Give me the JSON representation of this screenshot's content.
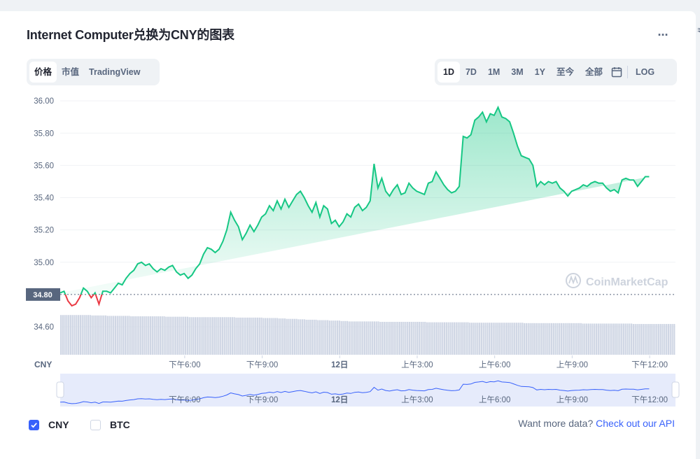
{
  "page": {
    "title": "Internet Computer兑换为CNY的图表",
    "edge_glyph": "₹",
    "more_label": "..."
  },
  "left_tabs": [
    {
      "label": "价格",
      "active": true
    },
    {
      "label": "市值",
      "active": false
    },
    {
      "label": "TradingView",
      "active": false
    }
  ],
  "range_tabs": [
    {
      "label": "1D",
      "active": true
    },
    {
      "label": "7D",
      "active": false
    },
    {
      "label": "1M",
      "active": false
    },
    {
      "label": "3M",
      "active": false
    },
    {
      "label": "1Y",
      "active": false
    },
    {
      "label": "至今",
      "active": false
    },
    {
      "label": "全部",
      "active": false
    }
  ],
  "icons": {
    "calendar": "calendar-icon",
    "check": "check-icon",
    "more": "more-horizontal-icon",
    "watermark": "coinmarketcap-logo-icon"
  },
  "log_label": "LOG",
  "watermark": "CoinMarketCap",
  "legend": {
    "cny": {
      "label": "CNY",
      "checked": true
    },
    "btc": {
      "label": "BTC",
      "checked": false
    }
  },
  "footer": {
    "prompt": "Want more data?",
    "link": "Check out our API"
  },
  "colors": {
    "up": "#16c784",
    "down": "#ea3943",
    "accent": "#3861fb",
    "volume": "#cfd6e4"
  },
  "chart_data": {
    "type": "line",
    "yticks": [
      "36.00",
      "35.80",
      "35.60",
      "35.40",
      "35.20",
      "35.00",
      "34.60"
    ],
    "ylim": [
      34.47,
      36.07
    ],
    "reference_value": 34.8,
    "reference_label": "34.80",
    "currency_label": "CNY",
    "x_tick_labels": [
      {
        "label": "下午6:00",
        "t": 4.82
      },
      {
        "label": "下午9:00",
        "t": 7.82
      },
      {
        "label": "12日",
        "t": 10.82
      },
      {
        "label": "上午3:00",
        "t": 13.82
      },
      {
        "label": "上午6:00",
        "t": 16.82
      },
      {
        "label": "上午9:00",
        "t": 19.82
      },
      {
        "label": "下午12:00",
        "t": 22.82
      }
    ],
    "x_range": [
      0,
      23.82
    ],
    "series": [
      {
        "t": [
          0,
          0.15,
          0.3,
          0.45,
          0.6,
          0.75,
          0.9,
          1.05,
          1.2,
          1.35,
          1.5,
          1.65,
          1.8,
          1.95,
          2.1,
          2.25,
          2.4,
          2.55,
          2.7,
          2.85,
          3.0,
          3.15,
          3.3,
          3.45,
          3.6,
          3.75,
          3.9,
          4.05,
          4.2,
          4.35,
          4.5,
          4.65,
          4.8,
          4.95,
          5.1,
          5.25,
          5.4,
          5.55,
          5.7,
          5.85,
          6.0,
          6.15,
          6.3,
          6.45,
          6.6,
          6.75,
          6.9,
          7.05,
          7.2,
          7.35,
          7.5,
          7.65,
          7.8,
          7.95,
          8.1,
          8.25,
          8.4,
          8.55,
          8.7,
          8.85,
          9.0,
          9.15,
          9.3,
          9.45,
          9.6,
          9.75,
          9.9,
          10.05,
          10.2,
          10.35,
          10.5,
          10.65,
          10.8,
          10.95,
          11.1,
          11.25,
          11.4,
          11.55,
          11.7,
          11.85,
          12.0,
          12.15,
          12.3,
          12.45,
          12.6,
          12.75,
          12.9,
          13.05,
          13.2,
          13.35,
          13.5,
          13.65,
          13.8,
          13.95,
          14.1,
          14.25,
          14.4,
          14.55,
          14.7,
          14.85,
          15.0,
          15.15,
          15.3,
          15.45,
          15.6,
          15.75,
          15.9,
          16.05,
          16.2,
          16.35,
          16.5,
          16.65,
          16.8,
          16.95,
          17.1,
          17.25,
          17.4,
          17.55,
          17.7,
          17.85,
          18.0,
          18.15,
          18.3,
          18.45,
          18.6,
          18.75,
          18.9,
          19.05,
          19.2,
          19.35,
          19.5,
          19.65,
          19.8,
          19.95,
          20.1,
          20.25,
          20.4,
          20.55,
          20.7,
          20.85,
          21.0,
          21.15,
          21.3,
          21.45,
          21.6,
          21.75,
          21.9,
          22.05,
          22.2,
          22.35,
          22.5,
          22.65,
          22.8,
          22.95,
          23.1,
          23.25,
          23.4,
          23.55,
          23.7,
          23.82
        ],
        "values": [
          34.81,
          34.82,
          34.76,
          34.73,
          34.74,
          34.78,
          34.84,
          34.82,
          34.78,
          34.81,
          34.74,
          34.82,
          34.82,
          34.81,
          34.84,
          34.87,
          34.86,
          34.9,
          34.93,
          34.95,
          34.99,
          35.0,
          34.98,
          34.99,
          34.96,
          34.94,
          34.96,
          34.95,
          34.97,
          34.98,
          34.94,
          34.92,
          34.93,
          34.9,
          34.92,
          34.96,
          34.99,
          35.05,
          35.09,
          35.08,
          35.06,
          35.08,
          35.13,
          35.2,
          35.31,
          35.26,
          35.22,
          35.14,
          35.18,
          35.23,
          35.19,
          35.23,
          35.28,
          35.3,
          35.35,
          35.32,
          35.38,
          35.33,
          35.39,
          35.34,
          35.38,
          35.42,
          35.44,
          35.4,
          35.35,
          35.31,
          35.37,
          35.28,
          35.35,
          35.33,
          35.24,
          35.26,
          35.22,
          35.25,
          35.3,
          35.28,
          35.34,
          35.36,
          35.32,
          35.34,
          35.38,
          35.61,
          35.46,
          35.52,
          35.44,
          35.41,
          35.45,
          35.48,
          35.42,
          35.43,
          35.49,
          35.46,
          35.44,
          35.43,
          35.42,
          35.49,
          35.5,
          35.56,
          35.52,
          35.48,
          35.45,
          35.43,
          35.44,
          35.47,
          35.78,
          35.77,
          35.79,
          35.88,
          35.9,
          35.93,
          35.87,
          35.92,
          35.91,
          35.96,
          35.9,
          35.89,
          35.87,
          35.8,
          35.72,
          35.66,
          35.65,
          35.64,
          35.6,
          35.47,
          35.5,
          35.48,
          35.5,
          35.49,
          35.5,
          35.46,
          35.44,
          35.41,
          35.44,
          35.45,
          35.46,
          35.48,
          35.47,
          35.49,
          35.5,
          35.49,
          35.49,
          35.46,
          35.44,
          35.45,
          35.43,
          35.51,
          35.52,
          35.51,
          35.51,
          35.47,
          35.5,
          35.53,
          35.53
        ]
      }
    ],
    "volume": [
      0.93,
      0.93,
      0.93,
      0.93,
      0.93,
      0.93,
      0.93,
      0.93,
      0.92,
      0.92,
      0.92,
      0.92,
      0.91,
      0.91,
      0.91,
      0.91,
      0.91,
      0.91,
      0.9,
      0.9,
      0.9,
      0.9,
      0.9,
      0.9,
      0.9,
      0.9,
      0.9,
      0.89,
      0.89,
      0.89,
      0.89,
      0.89,
      0.89,
      0.88,
      0.88,
      0.88,
      0.88,
      0.88,
      0.88,
      0.88,
      0.88,
      0.88,
      0.88,
      0.88,
      0.88,
      0.87,
      0.87,
      0.87,
      0.87,
      0.87,
      0.87,
      0.87,
      0.86,
      0.86,
      0.86,
      0.86,
      0.85,
      0.85,
      0.84,
      0.84,
      0.84,
      0.83,
      0.83,
      0.82,
      0.82,
      0.82,
      0.81,
      0.81,
      0.81,
      0.8,
      0.8,
      0.8,
      0.79,
      0.79,
      0.78,
      0.78,
      0.78,
      0.78,
      0.78,
      0.78,
      0.78,
      0.78,
      0.77,
      0.77,
      0.77,
      0.77,
      0.77,
      0.77,
      0.77,
      0.77,
      0.77,
      0.77,
      0.77,
      0.77,
      0.76,
      0.76,
      0.76,
      0.76,
      0.76,
      0.76,
      0.76,
      0.76,
      0.76,
      0.76,
      0.76,
      0.75,
      0.75,
      0.75,
      0.75,
      0.75,
      0.75,
      0.75,
      0.75,
      0.75,
      0.75,
      0.75,
      0.75,
      0.75,
      0.75,
      0.74,
      0.74,
      0.74,
      0.74,
      0.74,
      0.74,
      0.74,
      0.74,
      0.74,
      0.74,
      0.74,
      0.74,
      0.74,
      0.74,
      0.74,
      0.73,
      0.73,
      0.73,
      0.73,
      0.73,
      0.73,
      0.73,
      0.73,
      0.73,
      0.73,
      0.73,
      0.73,
      0.73,
      0.72,
      0.72,
      0.72,
      0.72,
      0.72,
      0.72,
      0.72,
      0.72,
      0.72,
      0.72,
      0.72
    ],
    "navigator_x_tick_labels": [
      "下午6:00",
      "下午9:00",
      "12日",
      "上午3:00",
      "上午6:00",
      "上午9:00",
      "下午12:00"
    ]
  }
}
